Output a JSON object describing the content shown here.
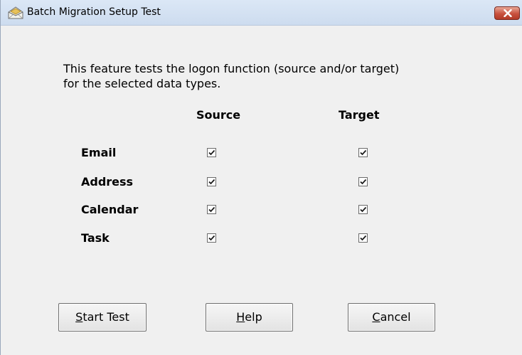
{
  "window": {
    "title": "Batch Migration Setup Test"
  },
  "description": {
    "line1": "This feature tests the logon function (source and/or target)",
    "line2": "for the selected data types."
  },
  "columns": {
    "source": "Source",
    "target": "Target"
  },
  "rows": [
    {
      "label": "Email",
      "source_checked": true,
      "target_checked": true
    },
    {
      "label": "Address",
      "source_checked": true,
      "target_checked": true
    },
    {
      "label": "Calendar",
      "source_checked": true,
      "target_checked": true
    },
    {
      "label": "Task",
      "source_checked": true,
      "target_checked": true
    }
  ],
  "buttons": {
    "start_test": {
      "mnemonic": "S",
      "rest": "tart Test"
    },
    "help": {
      "mnemonic": "H",
      "rest": "elp"
    },
    "cancel": {
      "mnemonic": "C",
      "rest": "ancel"
    }
  },
  "colors": {
    "window_bg": "#f0f0f0",
    "titlebar": "#d4e1f2",
    "close_button": "#c8513e"
  }
}
